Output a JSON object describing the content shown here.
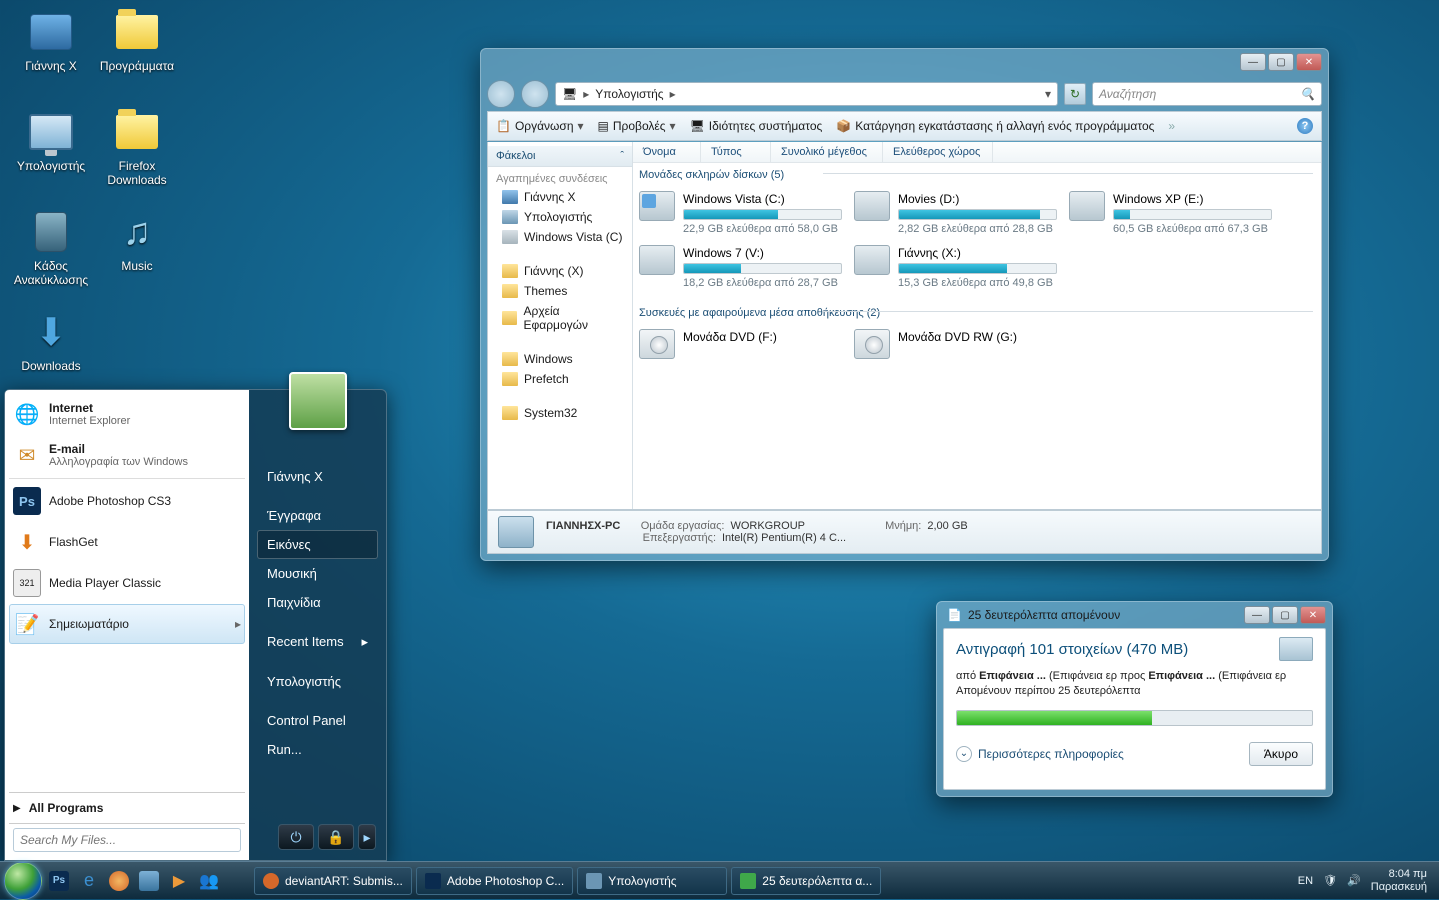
{
  "desktop": {
    "icons": [
      {
        "label": "Γιάννης X"
      },
      {
        "label": "Προγράμματα"
      },
      {
        "label": "Υπολογιστής"
      },
      {
        "label": "Firefox Downloads"
      },
      {
        "label": "Κάδος Ανακύκλωσης"
      },
      {
        "label": "Music"
      },
      {
        "label": "Downloads"
      }
    ]
  },
  "start_menu": {
    "left": {
      "internet": {
        "title": "Internet",
        "sub": "Internet Explorer"
      },
      "email": {
        "title": "E-mail",
        "sub": "Αλληλογραφία των Windows"
      },
      "apps": [
        "Adobe Photoshop CS3",
        "FlashGet",
        "Media Player Classic",
        "Σημειωματάριο"
      ],
      "all_programs": "All Programs",
      "search_placeholder": "Search My Files..."
    },
    "right": {
      "user": "Γιάννης X",
      "items": [
        "Έγγραφα",
        "Εικόνες",
        "Μουσική",
        "Παιχνίδια",
        "Recent Items",
        "Υπολογιστής",
        "Control Panel",
        "Run..."
      ],
      "selected_index": 1
    }
  },
  "explorer": {
    "breadcrumb_root": "Υπολογιστής",
    "search_placeholder": "Αναζήτηση",
    "toolbar": {
      "organize": "Οργάνωση",
      "views": "Προβολές",
      "system_props": "Ιδιότητες συστήματος",
      "uninstall": "Κατάργηση εγκατάστασης ή αλλαγή ενός προγράμματος"
    },
    "tree": {
      "header": "Φάκελοι",
      "fav_header": "Αγαπημένες συνδέσεις",
      "favs": [
        "Γιάννης X",
        "Υπολογιστής",
        "Windows Vista (C)"
      ],
      "links": [
        "Γιάννης (X)",
        "Themes",
        "Αρχεία Εφαρμογών",
        "Windows",
        "Prefetch",
        "System32"
      ]
    },
    "columns": [
      "Όνομα",
      "Τύπος",
      "Συνολικό μέγεθος",
      "Ελεύθερος χώρος"
    ],
    "group_hdd": "Μονάδες σκληρών δίσκων (5)",
    "group_removable": "Συσκευές με αφαιρούμενα μέσα αποθήκευσης (2)",
    "drives": [
      {
        "name": "Windows Vista (C:)",
        "free": "22,9 GB ελεύθερα από 58,0 GB",
        "pct": 60,
        "os": true
      },
      {
        "name": "Movies (D:)",
        "free": "2,82 GB ελεύθερα από 28,8 GB",
        "pct": 90,
        "os": false
      },
      {
        "name": "Windows XP (E:)",
        "free": "60,5 GB ελεύθερα από 67,3 GB",
        "pct": 10,
        "os": false
      },
      {
        "name": "Windows 7 (V:)",
        "free": "18,2 GB ελεύθερα από 28,7 GB",
        "pct": 36,
        "os": false
      },
      {
        "name": "Γιάννης (X:)",
        "free": "15,3 GB ελεύθερα από 49,8 GB",
        "pct": 69,
        "os": false
      }
    ],
    "dvds": [
      {
        "name": "Μονάδα DVD (F:)"
      },
      {
        "name": "Μονάδα DVD RW (G:)"
      }
    ],
    "status": {
      "pc_name": "ΓΙΑΝΝΗΣΧ-PC",
      "workgroup_label": "Ομάδα εργασίας:",
      "workgroup": "WORKGROUP",
      "cpu_label": "Επεξεργαστής:",
      "cpu": "Intel(R) Pentium(R) 4 C...",
      "mem_label": "Μνήμη:",
      "mem": "2,00 GB"
    }
  },
  "copy": {
    "title": "25 δευτερόλεπτα απομένουν",
    "heading": "Αντιγραφή 101 στοιχείων (470 MB)",
    "line1_a": "από ",
    "line1_b": "Επιφάνεια ...",
    "line1_c": " (Επιφάνεια ερ προς ",
    "line1_d": "Επιφάνεια ...",
    "line1_e": " (Επιφάνεια ερ",
    "line2": "Απομένουν περίπου 25 δευτερόλεπτα",
    "more": "Περισσότερες πληροφορίες",
    "cancel": "Άκυρο",
    "progress_pct": 55
  },
  "taskbar": {
    "items": [
      {
        "label": "deviantART: Submis..."
      },
      {
        "label": "Adobe Photoshop C..."
      },
      {
        "label": "Υπολογιστής"
      },
      {
        "label": "25 δευτερόλεπτα α..."
      }
    ],
    "lang": "EN",
    "time": "8:04 πμ",
    "day": "Παρασκευή"
  }
}
